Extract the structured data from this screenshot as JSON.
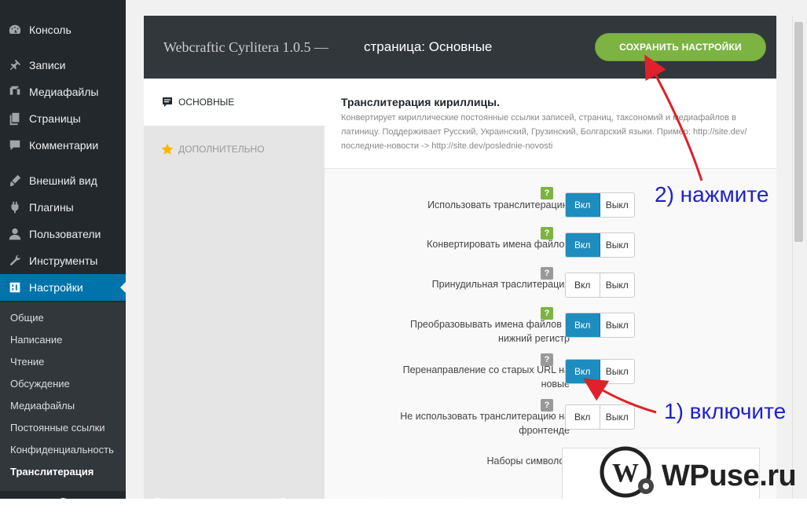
{
  "sidebar": {
    "items": [
      {
        "label": "Консоль",
        "icon": "dashboard-icon"
      },
      {
        "label": "Записи",
        "icon": "pin-icon"
      },
      {
        "label": "Медиафайлы",
        "icon": "media-icon"
      },
      {
        "label": "Страницы",
        "icon": "pages-icon"
      },
      {
        "label": "Комментарии",
        "icon": "comment-icon"
      },
      {
        "label": "Внешний вид",
        "icon": "brush-icon"
      },
      {
        "label": "Плагины",
        "icon": "plugin-icon"
      },
      {
        "label": "Пользователи",
        "icon": "user-icon"
      },
      {
        "label": "Инструменты",
        "icon": "wrench-icon"
      },
      {
        "label": "Настройки",
        "icon": "settings-icon"
      }
    ],
    "submenu": [
      "Общие",
      "Написание",
      "Чтение",
      "Обсуждение",
      "Медиафайлы",
      "Постоянные ссылки",
      "Конфиденциальность",
      "Транслитерация"
    ]
  },
  "header": {
    "plugin_title": "Webcraftic Cyrlitera 1.0.5 —",
    "page_label": "страница: Основные",
    "save_label": "СОХРАНИТЬ НАСТРОЙКИ"
  },
  "tabs": [
    {
      "label": "ОСНОВНЫЕ",
      "icon": "speech-bubble-icon"
    },
    {
      "label": "ДОПОЛНИТЕЛЬНО",
      "icon": "star-icon"
    }
  ],
  "section": {
    "title": "Транслитерация кириллицы.",
    "description": "Конвертирует кириллические постоянные ссылки записей, страниц, таксономий и медиафайлов в латиницу. Поддерживает Русский, Украинский, Грузинский, Болгарский языки. Пример: http://site.dev/последние-новости -> http://site.dev/poslednie-novosti"
  },
  "toggle_labels": {
    "on": "Вкл",
    "off": "Выкл"
  },
  "options": [
    {
      "label": "Использовать транслитерацию",
      "enabled": true,
      "help": "?"
    },
    {
      "label": "Конвертировать имена файлов",
      "enabled": true,
      "help": "?"
    },
    {
      "label": "Принудильная траслитерация",
      "enabled": false,
      "help": "?"
    },
    {
      "label": "Преобразовывать имена файлов в нижний регистр",
      "enabled": true,
      "help": "?"
    },
    {
      "label": "Перенаправление со старых URL на новые",
      "enabled": true,
      "help": "?"
    },
    {
      "label": "Не использовать транслитерацию на фронтенде",
      "enabled": false,
      "help": "?"
    }
  ],
  "charset_label": "Наборы символов",
  "annotations": {
    "step2": "2) нажмите",
    "step1": "1) включите"
  },
  "watermark": "WPuse.ru",
  "colors": {
    "sidebar_bg": "#23282d",
    "active_menu": "#0073aa",
    "save_button": "#7cb342",
    "toggle_on": "#1e8cbe",
    "arrow": "#e0202a",
    "annotation_text": "#1f1fd0"
  }
}
